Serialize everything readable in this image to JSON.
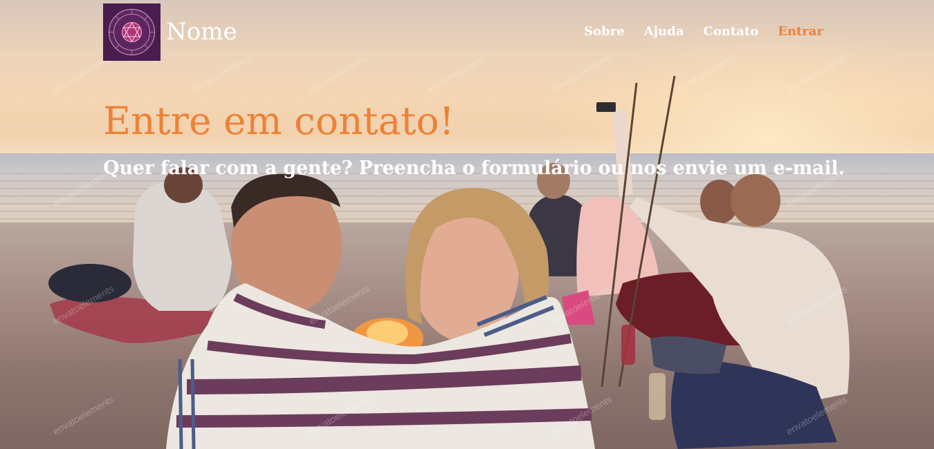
{
  "header": {
    "brand_name": "Nome",
    "logo_icon": "zodiac-wheel-icon"
  },
  "nav": {
    "items": [
      {
        "label": "Sobre",
        "active": false
      },
      {
        "label": "Ajuda",
        "active": false
      },
      {
        "label": "Contato",
        "active": false
      },
      {
        "label": "Entrar",
        "active": true
      }
    ]
  },
  "hero": {
    "title": "Entre em contato!",
    "subtitle": "Quer falar com a gente? Preencha o formulário ou nos envie um e-mail.",
    "background_image": "friends-at-beach-bonfire-photo",
    "watermark_text": "envatoelements"
  },
  "colors": {
    "accent": "#ee8137",
    "nav_text": "#ffffff",
    "logo_bg": "#4a1d4f"
  }
}
